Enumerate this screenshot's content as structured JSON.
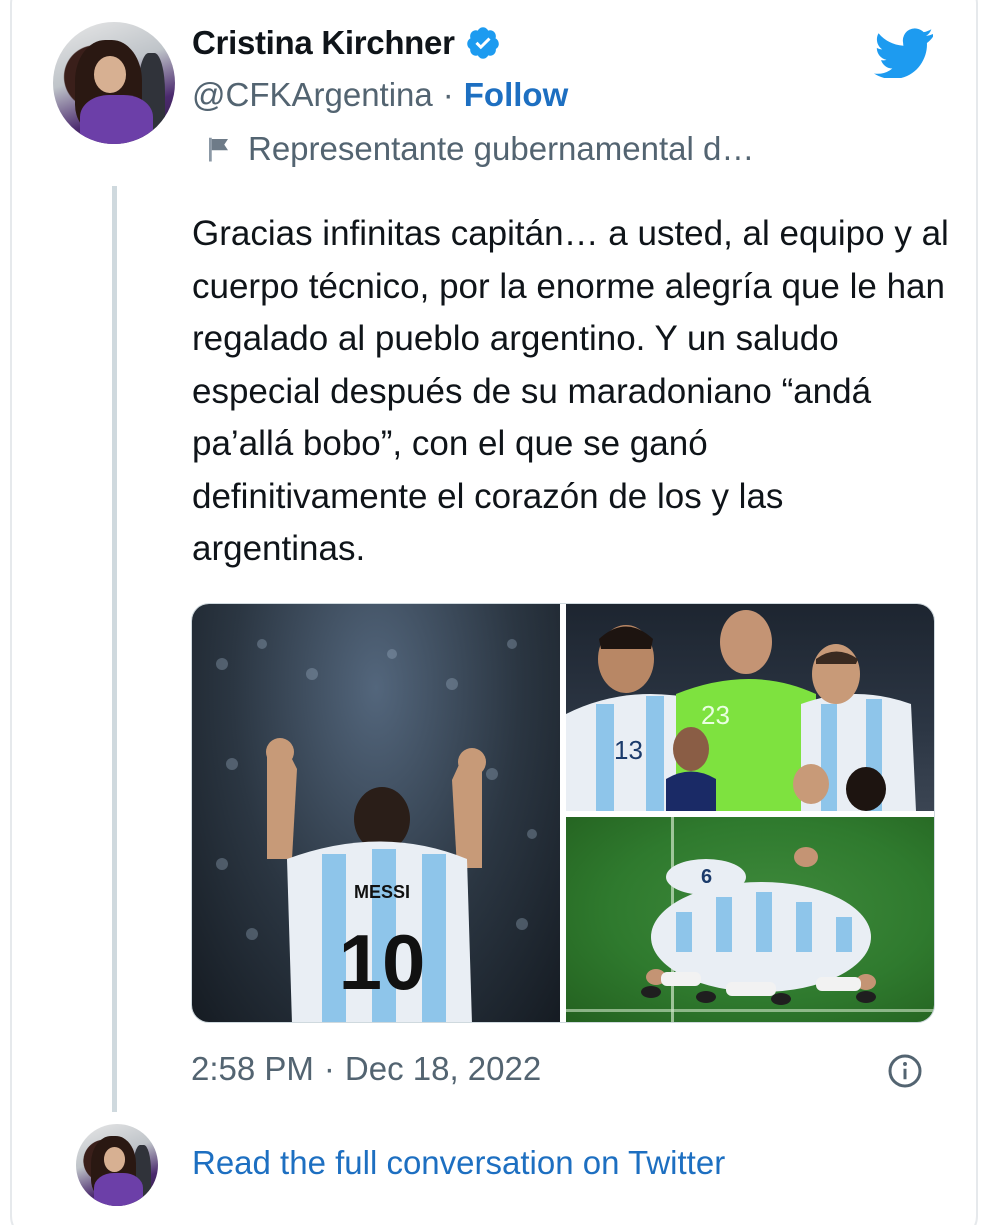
{
  "author": {
    "name": "Cristina Kirchner",
    "handle": "@CFKArgentina",
    "separator": "·",
    "follow_label": "Follow",
    "account_label": "Representante gubernamental d…",
    "verified": true
  },
  "tweet": {
    "text": "Gracias infinitas capitán… a usted, al equipo y al cuerpo técnico, por la enorme alegría que le han regalado al pueblo argentino. Y un saludo especial después de su maradoniano “andá pa’allá bobo”, con el que se ganó definitivamente el corazón de los y las argentinas.",
    "time": "2:58 PM",
    "separator": "·",
    "date": "Dec 18, 2022"
  },
  "media": {
    "photos": [
      {
        "jersey_name": "MESSI",
        "jersey_number": "10"
      },
      {
        "jersey_numbers": [
          "13",
          "23"
        ]
      },
      {
        "jersey_number": "6"
      }
    ]
  },
  "footer": {
    "read_link": "Read the full conversation on Twitter"
  },
  "colors": {
    "accent": "#1d6fc1",
    "twitter_blue": "#1d9bf0",
    "secondary_text": "#536471",
    "border": "#cfd9de"
  },
  "icons": [
    "verified-badge-icon",
    "flag-icon",
    "twitter-bird-icon",
    "info-icon"
  ]
}
